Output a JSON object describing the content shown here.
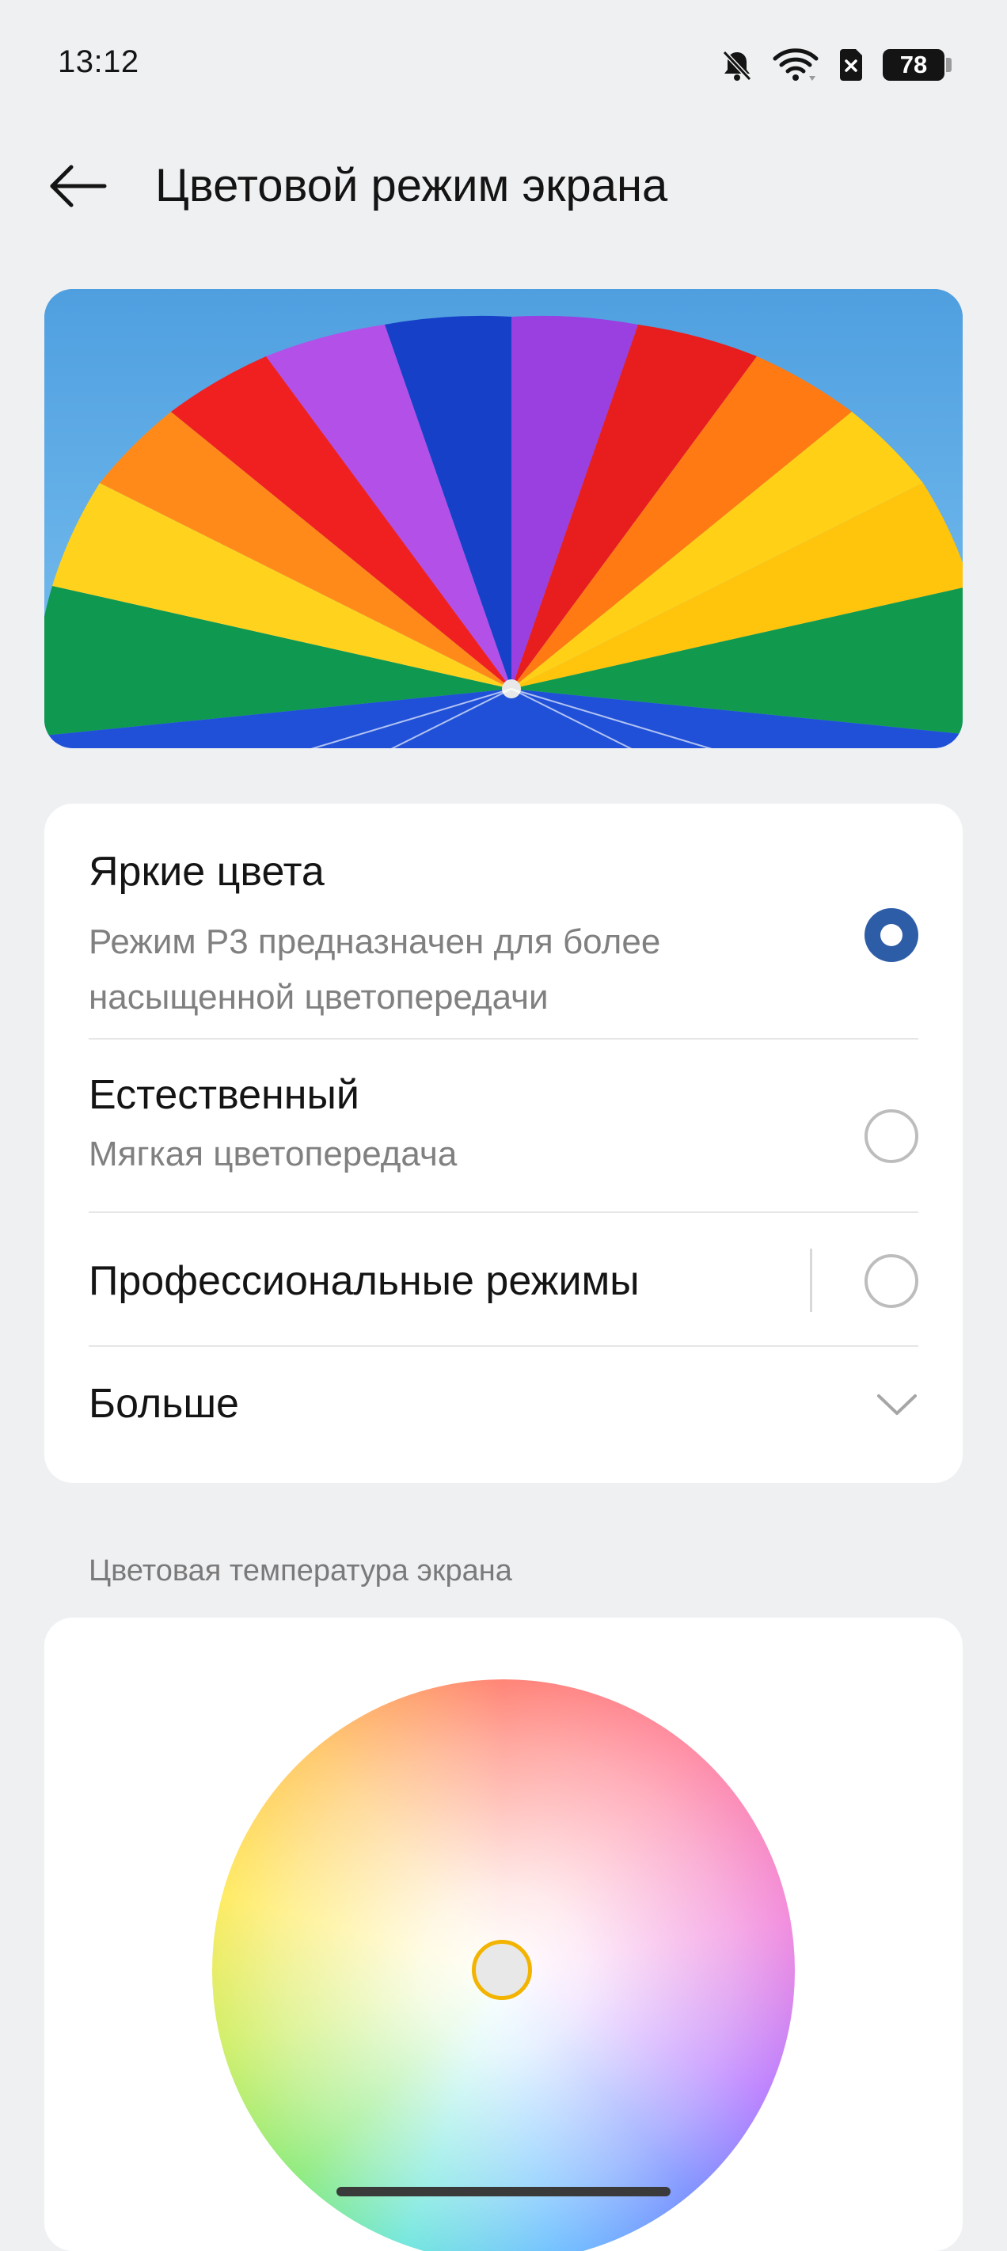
{
  "status_bar": {
    "time": "13:12",
    "battery": "78",
    "icons": [
      "bell-muted-icon",
      "wifi-icon",
      "sim-blocked-icon",
      "battery-icon"
    ]
  },
  "header": {
    "title": "Цветовой режим экрана",
    "back_icon": "arrow-left-icon"
  },
  "preview": {
    "image": "rainbow-parachute-photo"
  },
  "modes": {
    "vivid": {
      "title": "Яркие цвета",
      "desc": "Режим P3 предназначен для более насыщенной цветопередачи",
      "selected": true
    },
    "natural": {
      "title": "Естественный",
      "desc": "Мягкая цветопередача",
      "selected": false
    },
    "pro": {
      "title": "Профессиональные режимы",
      "selected": false
    },
    "more": {
      "title": "Больше",
      "icon": "chevron-down-icon"
    }
  },
  "color_temperature": {
    "label": "Цветовая температура экрана",
    "handle_color": "#f2b400"
  },
  "colors": {
    "accent": "#2e5da8",
    "background": "#eff0f2",
    "card": "#ffffff"
  }
}
